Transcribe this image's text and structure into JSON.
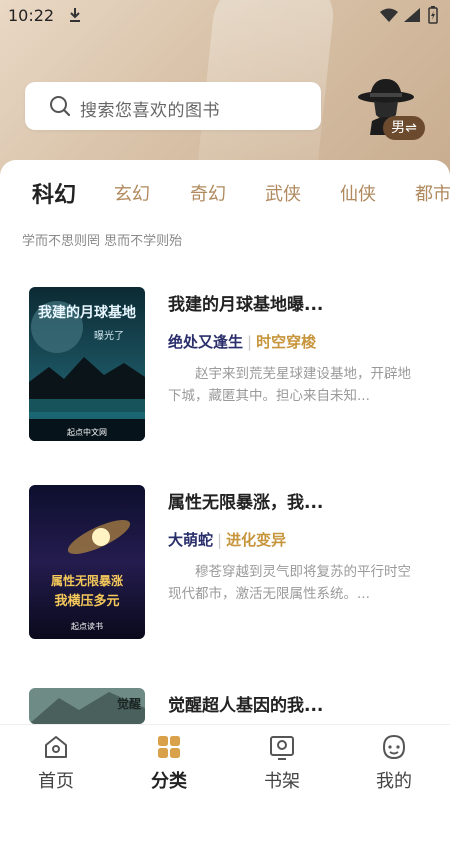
{
  "status": {
    "time": "10:22"
  },
  "search": {
    "placeholder": "搜索您喜欢的图书"
  },
  "profile": {
    "gender_badge": "男⇌"
  },
  "tabs": [
    "科幻",
    "玄幻",
    "奇幻",
    "武侠",
    "仙侠",
    "都市"
  ],
  "quote": "学而不思则罔 思而不学则殆",
  "books": [
    {
      "title": "我建的月球基地曝...",
      "author": "绝处又逢生",
      "separator": "|",
      "genre": "时空穿梭",
      "description": "赵宇来到荒芜星球建设基地，开辟地下城，藏匿其中。担心来自未知...",
      "cover_text": [
        "我建的月球基地",
        "曝光了",
        "起点中文网"
      ]
    },
    {
      "title": "属性无限暴涨，我...",
      "author": "大萌蛇",
      "separator": "|",
      "genre": "进化变异",
      "description": "穆苍穿越到灵气即将复苏的平行时空现代都市，激活无限属性系统。...",
      "cover_text": [
        "属性无限暴涨",
        "我横压多元",
        "起点读书"
      ]
    },
    {
      "title": "觉醒超人基因的我...",
      "cover_text": [
        "觉醒"
      ]
    }
  ],
  "nav": [
    {
      "label": "首页",
      "icon": "home-icon"
    },
    {
      "label": "分类",
      "icon": "category-icon"
    },
    {
      "label": "书架",
      "icon": "bookshelf-icon"
    },
    {
      "label": "我的",
      "icon": "profile-icon"
    }
  ],
  "colors": {
    "accent": "#c7953c",
    "tab_inactive": "#b08a5e",
    "author": "#2a2f6b",
    "header_bg": "#d8c2a8"
  }
}
